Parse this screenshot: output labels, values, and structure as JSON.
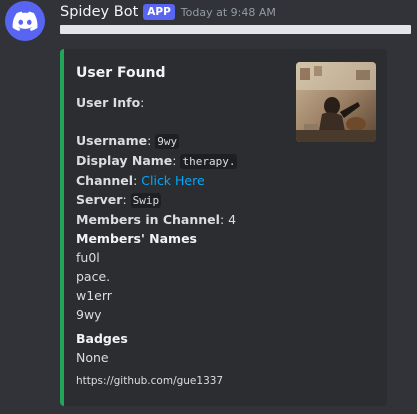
{
  "message": {
    "author": "Spidey Bot",
    "badge": "APP",
    "timestamp": "Today at 9:48 AM"
  },
  "embed": {
    "title": "User Found",
    "accent_color": "#23a559",
    "user_info_label": "User Info",
    "username_label": "Username",
    "username_value": "9wy",
    "display_name_label": "Display Name",
    "display_name_value": "therapy.",
    "channel_label": "Channel",
    "channel_link": "Click Here",
    "server_label": "Server",
    "server_value": "Swip",
    "members_label": "Members in Channel",
    "members_value": "4",
    "members_names_title": "Members' Names",
    "members_names": [
      "fu0l",
      "pace.",
      "w1err",
      "9wy"
    ],
    "badges_title": "Badges",
    "badges_value": "None",
    "footer": "https://github.com/gue1337"
  }
}
